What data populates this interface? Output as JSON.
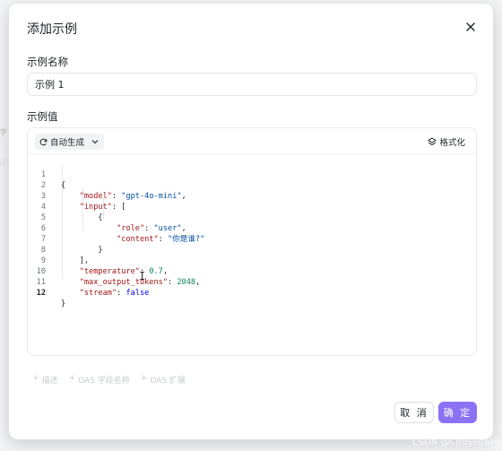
{
  "dialog": {
    "title": "添加示例",
    "name_label": "示例名称",
    "name_value": "示例 1",
    "value_label": "示例值",
    "autogen_label": "自动生成",
    "format_label": "格式化"
  },
  "code": {
    "active_line": 12,
    "lines": [
      {
        "n": "1",
        "text": "{"
      },
      {
        "n": "2",
        "text": "    \"model\": \"gpt-4o-mini\","
      },
      {
        "n": "3",
        "text": "    \"input\": ["
      },
      {
        "n": "4",
        "text": "        {"
      },
      {
        "n": "5",
        "text": "            \"role\": \"user\","
      },
      {
        "n": "6",
        "text": "            \"content\": \"你是谁?\""
      },
      {
        "n": "7",
        "text": "        }"
      },
      {
        "n": "8",
        "text": "    ],"
      },
      {
        "n": "9",
        "text": "    \"temperature\": 0.7,"
      },
      {
        "n": "10",
        "text": "    \"max_output_tokens\": 2048,"
      },
      {
        "n": "11",
        "text": "    \"stream\": false"
      },
      {
        "n": "12",
        "text": "}"
      }
    ]
  },
  "addons": [
    {
      "label": "描述"
    },
    {
      "label": "OAS 字段名称"
    },
    {
      "label": "OAS 扩展"
    }
  ],
  "footer": {
    "cancel_label": "取 消",
    "ok_label": "确 定"
  },
  "watermark": "CSDN @ChoSeitaku",
  "icons": {
    "close": "close-icon",
    "autogen": "refresh-icon",
    "dropdown": "chevron-down-icon",
    "format": "format-icon",
    "add": "plus-icon"
  },
  "colors": {
    "primary": "#8b72f4",
    "json_key": "#a31515",
    "json_string": "#0451a5",
    "json_number": "#098658",
    "json_boolean": "#0000ff"
  }
}
